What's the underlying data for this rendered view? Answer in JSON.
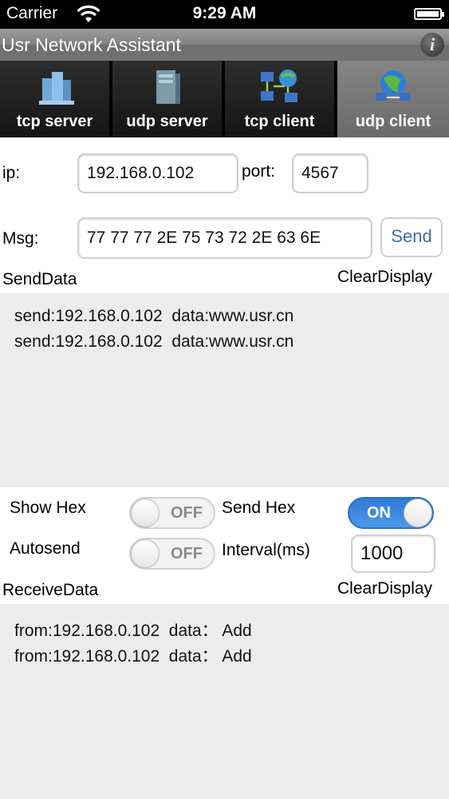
{
  "status_bar": {
    "carrier": "Carrier",
    "time": "9:29 AM"
  },
  "navbar": {
    "title": "Usr Network Assistant",
    "info_glyph": "i"
  },
  "tabs": [
    {
      "label": "tcp server",
      "icon": "server-building-icon"
    },
    {
      "label": "udp server",
      "icon": "server-tower-icon"
    },
    {
      "label": "tcp client",
      "icon": "network-computers-icon"
    },
    {
      "label": "udp client",
      "icon": "globe-network-icon",
      "active": true
    }
  ],
  "form": {
    "ip_label": "ip:",
    "ip_value": "192.168.0.102",
    "port_label": "port:",
    "port_value": "4567",
    "msg_label": "Msg:",
    "msg_value": "77 77 77 2E 75 73 72 2E 63 6E",
    "send_button": "Send"
  },
  "send_section": {
    "title": "SendData",
    "clear_label": "ClearDisplay",
    "lines": [
      "send:192.168.0.102  data:www.usr.cn",
      "send:192.168.0.102  data:www.usr.cn"
    ]
  },
  "options": {
    "show_hex_label": "Show Hex",
    "show_hex_state": "OFF",
    "send_hex_label": "Send Hex",
    "send_hex_state": "ON",
    "autosend_label": "Autosend",
    "autosend_state": "OFF",
    "interval_label": "Interval(ms)",
    "interval_value": "1000"
  },
  "receive_section": {
    "title": "ReceiveData",
    "clear_label": "ClearDisplay",
    "lines": [
      "from:192.168.0.102  data： Add",
      "from:192.168.0.102  data： Add"
    ]
  },
  "colors": {
    "switch_on": "#3b86df",
    "link_blue": "#3a6ea5",
    "panel_gray": "#ececec"
  }
}
